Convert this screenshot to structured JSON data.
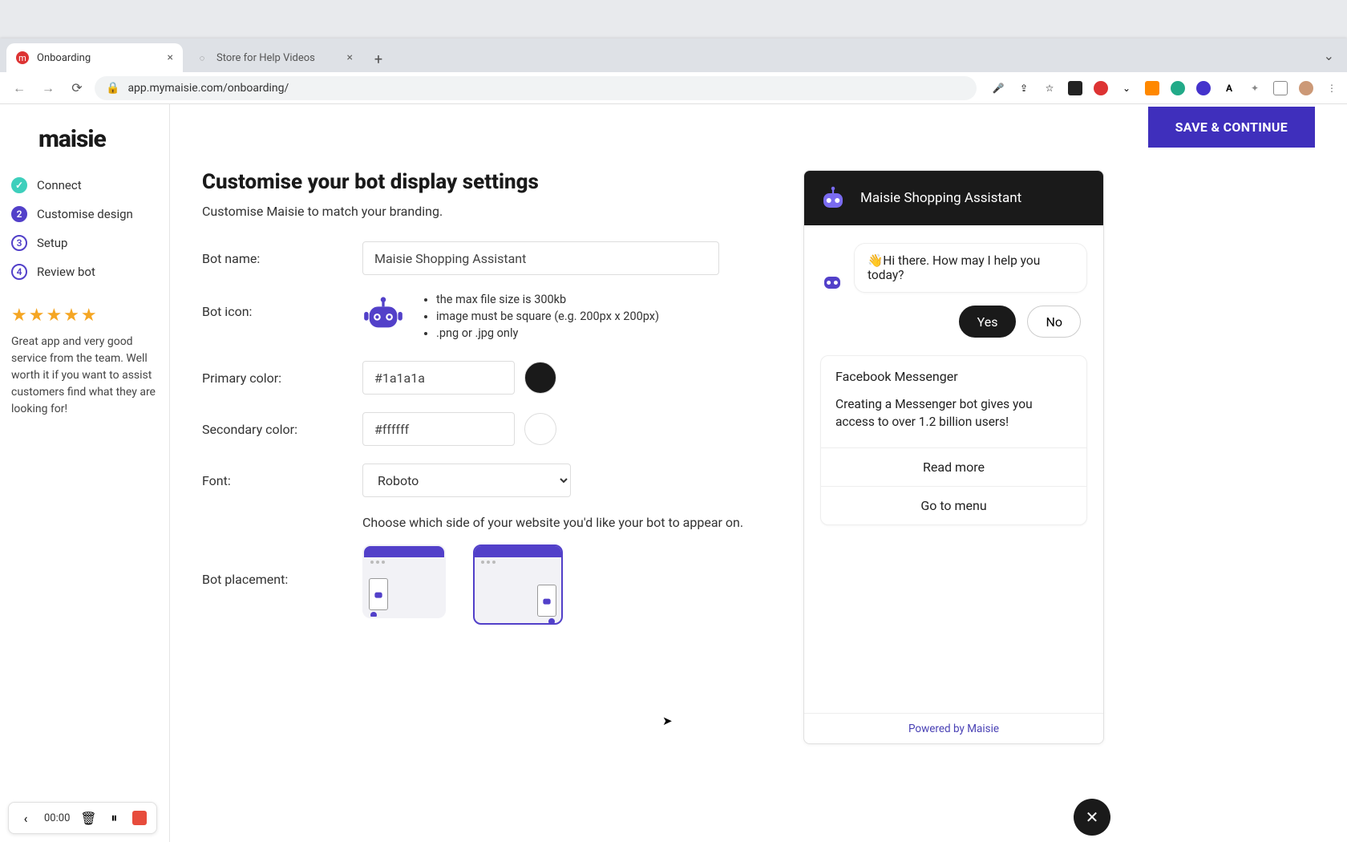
{
  "browser": {
    "tabs": [
      {
        "title": "Onboarding",
        "active": true,
        "favicon_color": "#d33"
      },
      {
        "title": "Store for Help Videos",
        "active": false,
        "favicon_color": "#888"
      }
    ],
    "url": "app.mymaisie.com/onboarding/"
  },
  "brand": {
    "logo_text": "maisie"
  },
  "steps": [
    {
      "label": "Connect",
      "state": "done",
      "num": "✓"
    },
    {
      "label": "Customise design",
      "state": "active",
      "num": "2"
    },
    {
      "label": "Setup",
      "state": "pending",
      "num": "3"
    },
    {
      "label": "Review bot",
      "state": "pending",
      "num": "4"
    }
  ],
  "sidebar_review": {
    "stars": "★★★★★",
    "text": "Great app and very good service from the team. Well worth it if you want to assist customers find what they are looking for!"
  },
  "topbar": {
    "save_label": "SAVE & CONTINUE"
  },
  "page": {
    "title": "Customise your bot display settings",
    "subtitle": "Customise Maisie to match your branding.",
    "labels": {
      "bot_name": "Bot name:",
      "bot_icon": "Bot icon:",
      "primary_color": "Primary color:",
      "secondary_color": "Secondary color:",
      "font": "Font:",
      "bot_placement": "Bot placement:"
    },
    "values": {
      "bot_name": "Maisie Shopping Assistant",
      "primary_color": "#1a1a1a",
      "secondary_color": "#ffffff",
      "font": "Roboto"
    },
    "icon_rules": [
      "the max file size is 300kb",
      "image must be square (e.g. 200px x 200px)",
      ".png or .jpg only"
    ],
    "placement_hint": "Choose which side of your website you'd like your bot to appear on.",
    "placement_selected": "right"
  },
  "preview": {
    "header_title": "Maisie Shopping Assistant",
    "greeting": "👋Hi there. How may I help you today?",
    "quick_replies": {
      "yes": "Yes",
      "no": "No"
    },
    "card": {
      "title": "Facebook Messenger",
      "text": "Creating a Messenger bot gives you access to over 1.2 billion users!",
      "read_more": "Read more",
      "menu": "Go to menu"
    },
    "footer": "Powered by Maisie"
  },
  "recorder": {
    "time": "00:00"
  },
  "colors": {
    "brand_purple": "#5240c9",
    "primary_swatch": "#1a1a1a",
    "secondary_swatch": "#ffffff"
  }
}
